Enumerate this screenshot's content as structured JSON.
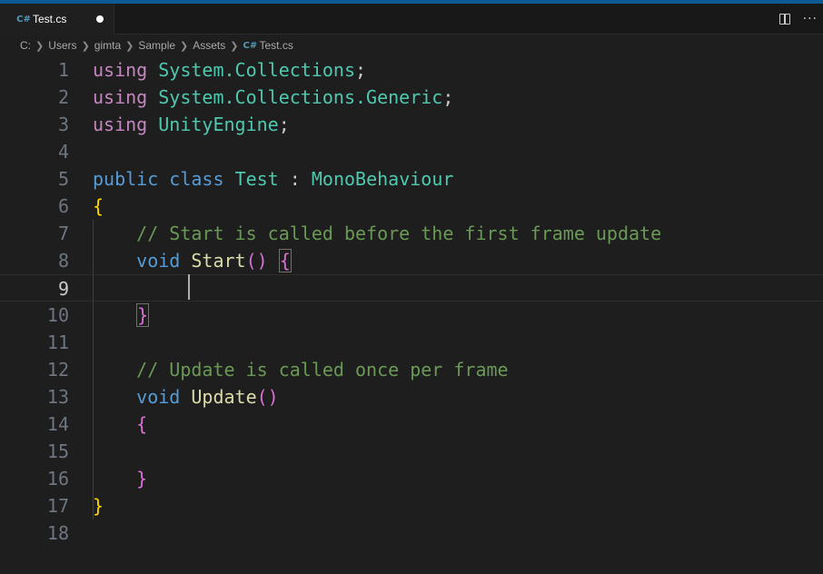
{
  "tab": {
    "icon": "C#",
    "label": "Test.cs"
  },
  "breadcrumb": {
    "parts": [
      "C:",
      "Users",
      "gimta",
      "Sample",
      "Assets"
    ],
    "file_icon": "C#",
    "file": "Test.cs"
  },
  "actions": {
    "more": "···"
  },
  "editor": {
    "current_line": 9,
    "line_numbers": [
      "1",
      "2",
      "3",
      "4",
      "5",
      "6",
      "7",
      "8",
      "9",
      "10",
      "11",
      "12",
      "13",
      "14",
      "15",
      "16",
      "17",
      "18"
    ],
    "code": {
      "l1_kw": "using",
      "l1_ns": "System.Collections",
      "l1_semi": ";",
      "l2_kw": "using",
      "l2_ns": "System.Collections.Generic",
      "l2_semi": ";",
      "l3_kw": "using",
      "l3_ns": "UnityEngine",
      "l3_semi": ";",
      "l5_public": "public",
      "l5_class": "class",
      "l5_name": "Test",
      "l5_colon": ":",
      "l5_base": "MonoBehaviour",
      "l6_brace": "{",
      "l7_comment": "// Start is called before the first frame update",
      "l8_void": "void",
      "l8_fn": "Start",
      "l8_parens": "()",
      "l8_brace": "{",
      "l10_brace": "}",
      "l12_comment": "// Update is called once per frame",
      "l13_void": "void",
      "l13_fn": "Update",
      "l13_parens": "()",
      "l14_brace": "{",
      "l16_brace": "}",
      "l17_brace": "}"
    }
  },
  "colors": {
    "keyword": "#c586c0",
    "storage": "#569cd6",
    "type": "#4ec9b0",
    "function": "#dcdcaa",
    "comment": "#6a9955",
    "bracket1": "#ffd700",
    "bracket2": "#da70d6"
  }
}
